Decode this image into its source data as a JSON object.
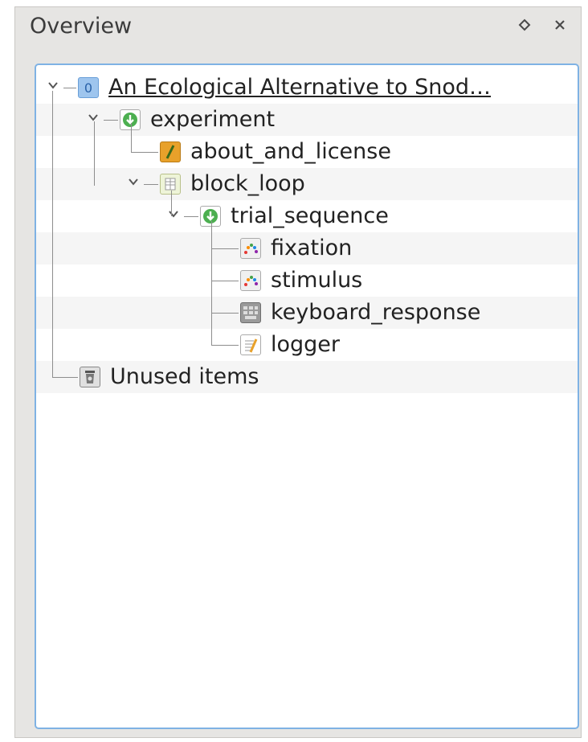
{
  "panel": {
    "title": "Overview",
    "float_icon": "diamond-icon",
    "close_icon": "close-icon"
  },
  "tree": {
    "items": [
      {
        "label": "An Ecological Alternative to Snod…",
        "icon": "experiment-root-icon",
        "expanded": true
      },
      {
        "label": "experiment",
        "icon": "sequence-icon",
        "expanded": true
      },
      {
        "label": "about_and_license",
        "icon": "notepad-icon"
      },
      {
        "label": "block_loop",
        "icon": "loop-icon",
        "expanded": true
      },
      {
        "label": "trial_sequence",
        "icon": "sequence-icon",
        "expanded": true
      },
      {
        "label": "fixation",
        "icon": "sketchpad-icon"
      },
      {
        "label": "stimulus",
        "icon": "sketchpad-icon"
      },
      {
        "label": "keyboard_response",
        "icon": "keyboard-icon"
      },
      {
        "label": "logger",
        "icon": "logger-icon"
      },
      {
        "label": "Unused items",
        "icon": "trash-icon"
      }
    ]
  },
  "colors": {
    "selection_border": "#7fb2e4",
    "sequence_green": "#4caf50",
    "notepad_orange": "#e8a12a"
  }
}
